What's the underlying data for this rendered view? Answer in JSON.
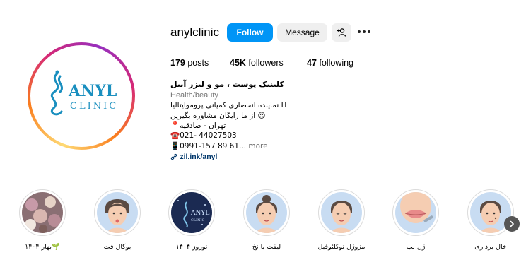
{
  "profile": {
    "username": "anylclinic",
    "follow_label": "Follow",
    "message_label": "Message",
    "posts_count": "179",
    "posts_label": "posts",
    "followers_count": "45K",
    "followers_label": "followers",
    "following_count": "47",
    "following_label": "following",
    "logo_text_1": "ANYL",
    "logo_text_2": "CLINIC"
  },
  "bio": {
    "name": "کلینیک پوست ، مو و لیزر آنیل",
    "category": "Health/beauty",
    "line1": "نماینده انحصاری کمپانی پروموایتالیا IT",
    "line2": "از ما رایگان مشاوره بگیرین 😍",
    "line3": "📍تهران - صادقیه",
    "line4": "021- 44027503",
    "line5": "0991-157 89 61...",
    "more": "more",
    "link": "zil.ink/anyl"
  },
  "highlights": [
    {
      "label": "بهار ۱۴۰۴🌱",
      "icon": "flowers-photo"
    },
    {
      "label": "بوکال فت",
      "icon": "face-illustration"
    },
    {
      "label": "نوروز ۱۴۰۴",
      "icon": "clinic-logo"
    },
    {
      "label": "لیفت با نخ",
      "icon": "face-illustration"
    },
    {
      "label": "مزوژل نوکلئوفیل",
      "icon": "face-illustration"
    },
    {
      "label": "ژل لب",
      "icon": "lips-illustration"
    },
    {
      "label": "خال برداری",
      "icon": "face-illustration"
    }
  ],
  "colors": {
    "follow_button": "#0095f6",
    "brand_teal": "#1a8fbf",
    "link": "#00376b"
  }
}
